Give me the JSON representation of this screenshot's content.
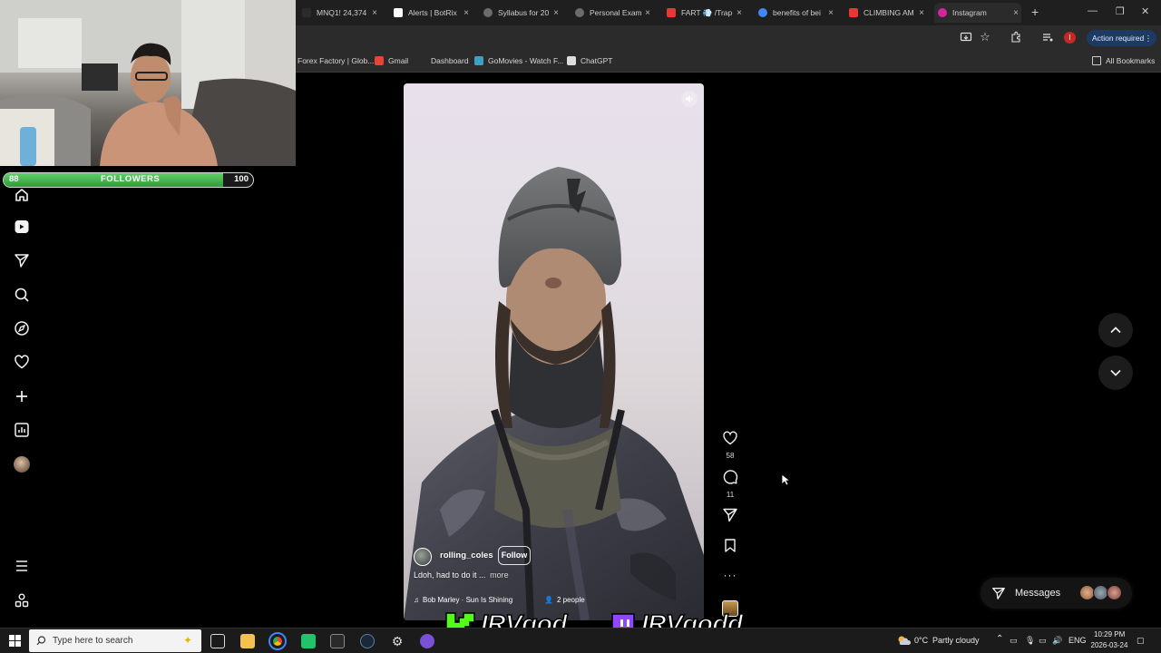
{
  "browser": {
    "tabs": [
      {
        "label": "MNQ1! 24,374",
        "icon": "tradingview-icon",
        "color": "#2b2b2b"
      },
      {
        "label": "Alerts | BotRix",
        "icon": "botrix-icon",
        "color": "#ffffff"
      },
      {
        "label": "Syllabus for 20",
        "icon": "globe-icon",
        "color": "#6b6b6b"
      },
      {
        "label": "Personal Exam",
        "icon": "globe-icon",
        "color": "#6b6b6b"
      },
      {
        "label": "FART 💨 /Trap",
        "icon": "youtube-icon",
        "color": "#e53935"
      },
      {
        "label": "benefits of bei",
        "icon": "google-icon",
        "color": "#4285f4"
      },
      {
        "label": "CLIMBING AM",
        "icon": "youtube-icon",
        "color": "#e53935"
      },
      {
        "label": "Instagram",
        "icon": "instagram-icon",
        "color": "#d6249f",
        "active": true
      }
    ],
    "action_required": "Action required",
    "profile_initial": "I",
    "bookmarks": [
      {
        "label": "Forex Factory | Glob...",
        "icon": "forex-icon"
      },
      {
        "label": "Gmail",
        "icon": "gmail-icon"
      },
      {
        "label": "Dashboard",
        "icon": "dashboard-icon"
      },
      {
        "label": "GoMovies - Watch F...",
        "icon": "gomovies-icon"
      },
      {
        "label": "ChatGPT",
        "icon": "chatgpt-icon"
      }
    ],
    "all_bookmarks": "All Bookmarks"
  },
  "stream_overlay": {
    "followers_label": "FOLLOWERS",
    "followers_current": "88",
    "followers_goal": "100",
    "followers_progress": 0.88,
    "kick_name": "IRVgod",
    "twitch_name": "IRVgodd"
  },
  "instagram": {
    "sidebar": [
      "home-icon",
      "reels-icon",
      "direct-icon",
      "search-icon",
      "explore-icon",
      "notifications-icon",
      "create-icon",
      "dashboard-icon",
      "profile-avatar",
      "more-menu-icon",
      "also-from-meta-icon"
    ],
    "reel": {
      "username": "rolling_coles",
      "follow_label": "Follow",
      "caption": "Ldoh, had to do it ...",
      "more_label": "more",
      "audio": "Bob Marley · Sun Is Shining",
      "tagged_people": "2 people"
    },
    "actions": {
      "likes": "58",
      "comments": "11"
    },
    "messages_label": "Messages"
  },
  "taskbar": {
    "search_placeholder": "Type here to search",
    "weather_temp": "0°C",
    "weather_desc": "Partly cloudy",
    "language": "ENG",
    "time": "10:29 PM",
    "date": "2026-03-24"
  }
}
